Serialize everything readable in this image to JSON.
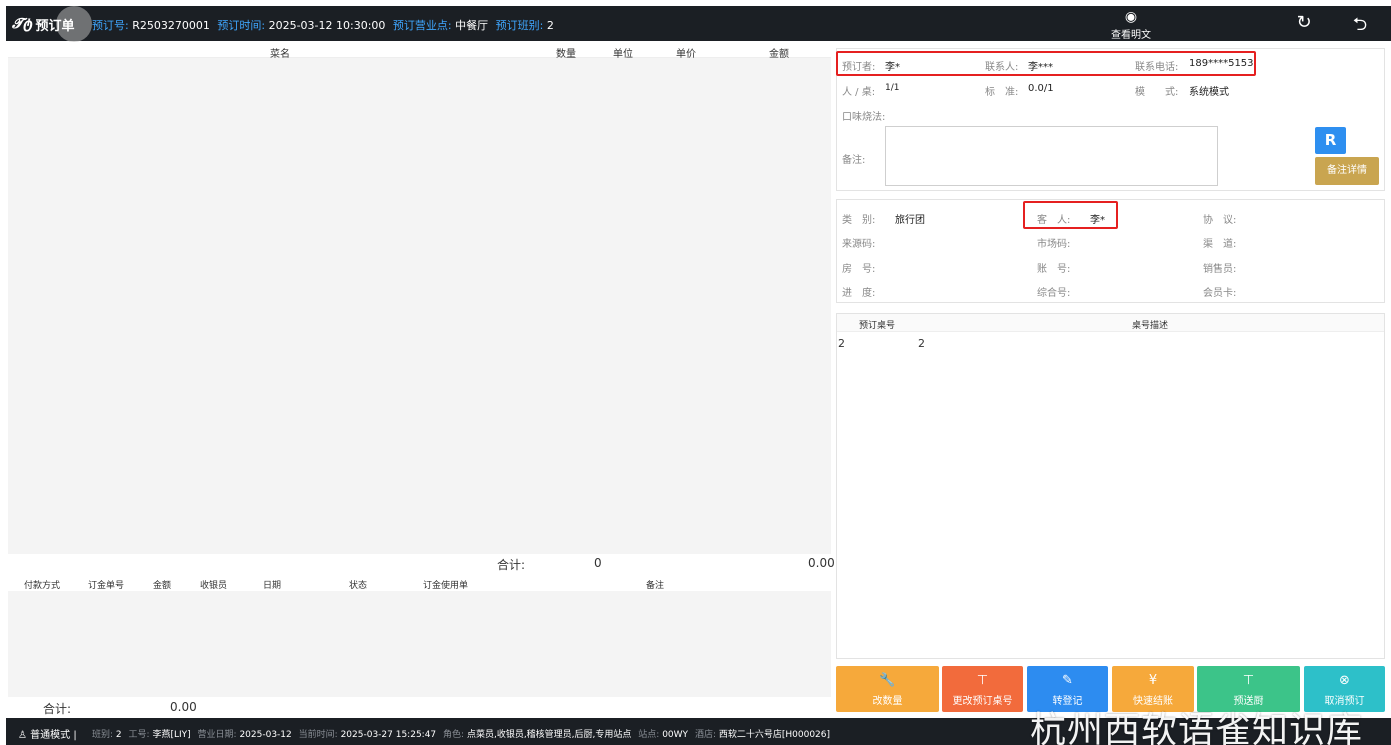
{
  "topbar": {
    "brand_logo": "𝓣ტ",
    "title": "预订单",
    "order_no_label": "预订号:",
    "order_no": "R2503270001",
    "time_label": "预订时间:",
    "time": "2025-03-12 10:30:00",
    "outlet_label": "预订营业点:",
    "outlet": "中餐厅",
    "shift_label": "预订班别:",
    "shift": "2",
    "view_detail_label": "查看明文",
    "refresh_icon": "↻",
    "back_icon": "⮌",
    "eye_icon": "◉"
  },
  "dish_grid": {
    "headers": [
      "菜名",
      "数量",
      "单位",
      "单价",
      "金额"
    ],
    "total_label": "合计:",
    "total_qty": "0",
    "total_amount": "0.00"
  },
  "payment_grid": {
    "headers": [
      "付款方式",
      "订金单号",
      "金额",
      "收银员",
      "日期",
      "状态",
      "订金使用单",
      "备注"
    ],
    "total_label": "合计:",
    "total_amount": "0.00"
  },
  "booking_info": {
    "booker_label": "预订者:",
    "booker": "李*",
    "contact_label": "联系人:",
    "contact": "李***",
    "phone_label": "联系电话:",
    "phone": "189****5153",
    "pax_label": "人 / 桌:",
    "pax": "1/1",
    "standard_label": "标　准:",
    "standard": "0.0/1",
    "mode_label": "模　　式:",
    "mode": "系统模式",
    "taste_label": "口味烧法:",
    "remark_label": "备注:",
    "r_button": "R",
    "remark_detail_button": "备注详情"
  },
  "guest_info": {
    "category_label": "类　别:",
    "category": "旅行团",
    "guest_label": "客　人:",
    "guest": "李*",
    "agreement_label": "协　议:",
    "source_label": "来源码:",
    "market_label": "市场码:",
    "channel_label": "渠　道:",
    "room_label": "房　号:",
    "account_label": "账　号:",
    "sales_label": "销售员:",
    "progress_label": "进　度:",
    "combined_label": "综合号:",
    "member_label": "会员卡:"
  },
  "table_list": {
    "headers": [
      "预订桌号",
      "桌号描述"
    ],
    "rows": [
      {
        "table_no": "2",
        "desc": "2"
      }
    ]
  },
  "actions": [
    {
      "label": "改数量",
      "icon": "🔧",
      "color": "#f6a93b"
    },
    {
      "label": "更改预订桌号",
      "icon": "⊤",
      "color": "#f26b3c"
    },
    {
      "label": "转登记",
      "icon": "✎",
      "color": "#2d8cf0"
    },
    {
      "label": "快速结账",
      "icon": "¥",
      "color": "#f6a93b"
    },
    {
      "label": "预送厨",
      "icon": "⊤",
      "color": "#3cc489"
    },
    {
      "label": "取消预订",
      "icon": "⊗",
      "color": "#2dc0c9"
    }
  ],
  "statusbar": {
    "user_icon": "♙",
    "mode": "普通模式",
    "shift_label": "班别:",
    "shift": "2",
    "staff_label": "工号:",
    "staff": "李燕[LIY]",
    "biz_date_label": "营业日期:",
    "biz_date": "2025-03-12",
    "now_label": "当前时间:",
    "now": "2025-03-27 15:25:47",
    "role_label": "角色:",
    "role": "点菜员,收银员,稽核管理员,后厨,专用站点",
    "station_label": "站点:",
    "station": "00WY",
    "hotel_label": "酒店:",
    "hotel": "西软二十六号店[H000026]"
  },
  "watermark": "杭州西软语雀知识库"
}
